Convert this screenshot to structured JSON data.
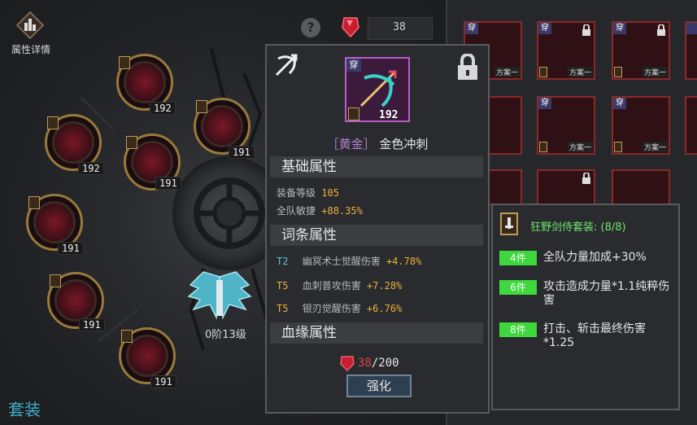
{
  "header": {
    "attr_detail_label": "属性详情",
    "gem_count": "38"
  },
  "left": {
    "slots": [
      {
        "level": "192"
      },
      {
        "level": "191"
      },
      {
        "level": "192"
      },
      {
        "level": "191"
      },
      {
        "level": "191"
      },
      {
        "level": "191"
      },
      {
        "level": "191"
      }
    ],
    "wings_label": "0阶13级",
    "set_title": "套装"
  },
  "tooltip": {
    "item_tag": "穿",
    "item_level": "192",
    "grade": "［黄金］",
    "name": "金色冲刺",
    "basic_title": "基础属性",
    "basic_stats": [
      {
        "label": "装备等级",
        "value": "105"
      },
      {
        "label": "全队敏捷",
        "value": "+88.35%"
      }
    ],
    "affix_title": "词条属性",
    "affix_stats": [
      {
        "tier": "T2",
        "label": "幽冥术士觉醒伤害",
        "value": "+4.78%"
      },
      {
        "tier": "T5",
        "label": "血刺普攻伤害",
        "value": "+7.28%"
      },
      {
        "tier": "T5",
        "label": "银刃觉醒伤害",
        "value": "+6.76%"
      }
    ],
    "lineage_title": "血缘属性",
    "dust_current": "38",
    "dust_max": "/200",
    "enhance_label": "强化"
  },
  "grid": {
    "cells": [
      {
        "tag": "穿",
        "plan": "方案一"
      },
      {
        "tag": "穿",
        "plan": "方案一"
      },
      {
        "tag": "穿",
        "plan": "方案一"
      },
      {
        "tag": "",
        "plan": "方案一"
      },
      {
        "tag": "穿",
        "plan": "方案一"
      },
      {
        "tag": "穿",
        "plan": "方案一"
      },
      {
        "tag": "",
        "plan": ""
      },
      {
        "tag": "",
        "plan": ""
      },
      {
        "tag": "",
        "plan": ""
      }
    ]
  },
  "set_bonus": {
    "name": "狂野剑侍套装: (8/8)",
    "items": [
      {
        "count": "4件",
        "text": "全队力量加成+30%"
      },
      {
        "count": "6件",
        "text": "攻击造成力量*1.1纯粹伤害"
      },
      {
        "count": "8件",
        "text": "打击、斩击最终伤害*1.25"
      }
    ]
  },
  "colors": {
    "accent_gold": "#e8b23c",
    "grade_purple": "#b57fd8",
    "set_green": "#6ee66e",
    "badge_green": "#3ed83e",
    "dust_red": "#e0404a"
  }
}
